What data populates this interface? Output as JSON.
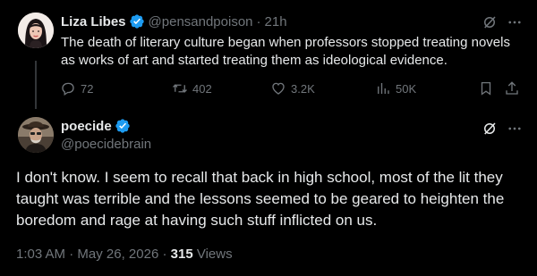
{
  "colors": {
    "background": "#000000",
    "text_primary": "#e7e9ea",
    "text_secondary": "#71767b",
    "verified": "#1d9bf0",
    "thread_line": "#333639"
  },
  "parent_tweet": {
    "author_name": "Liza Libes",
    "handle": "@pensandpoison",
    "separator": "·",
    "time": "21h",
    "text": "The death of literary culture began when professors stopped treating novels as works of art and started treating them as ideological evidence.",
    "actions": {
      "replies": "72",
      "retweets": "402",
      "likes": "3.2K",
      "views": "50K"
    },
    "icons": [
      "verified-icon",
      "grok-icon",
      "more-icon",
      "reply-icon",
      "retweet-icon",
      "like-icon",
      "views-icon",
      "bookmark-icon",
      "share-icon"
    ]
  },
  "reply_tweet": {
    "author_name": "poecide",
    "handle": "@poecidebrain",
    "text": "I don't know. I seem to recall that back in high school, most of the lit they taught was terrible and the lessons seemed to be geared to heighten the boredom and rage at having such stuff inflicted on us.",
    "time": "1:03 AM",
    "separator1": "·",
    "date": "May 26, 2026",
    "separator2": "·",
    "views_count": "315",
    "views_label": "Views"
  }
}
